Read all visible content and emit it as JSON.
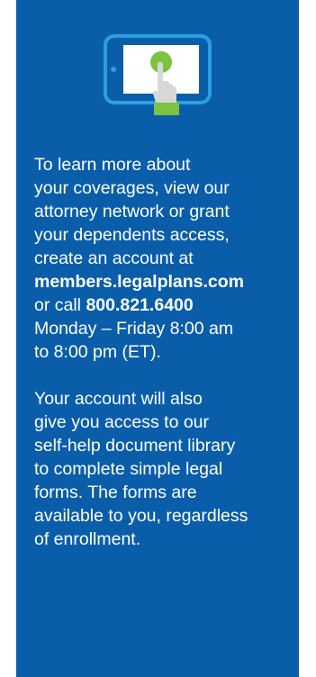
{
  "colors": {
    "panel_background": "#0a5ea9",
    "text": "#ffffff",
    "accent_green": "#7dc242",
    "icon_border": "#2b9fe0",
    "screen": "#ffffff",
    "hand": "#d8d8d8"
  },
  "icon": {
    "semantic_name": "tablet-tap-icon"
  },
  "paragraph1": {
    "line1": "To learn more about",
    "line2": "your coverages, view our",
    "line3": "attorney network or grant",
    "line4": "your dependents access,",
    "line5": "create an account at",
    "website": "members.legalplans.com",
    "call_prefix": "or call ",
    "phone": "800.821.6400",
    "line8": "Monday – Friday 8:00 am",
    "line9": "to 8:00 pm (ET)."
  },
  "paragraph2": {
    "line1": "Your account will also",
    "line2": "give you access to our",
    "line3": "self-help document library",
    "line4": "to complete simple legal",
    "line5": "forms. The forms are",
    "line6": "available to you, regardless",
    "line7": "of enrollment."
  }
}
